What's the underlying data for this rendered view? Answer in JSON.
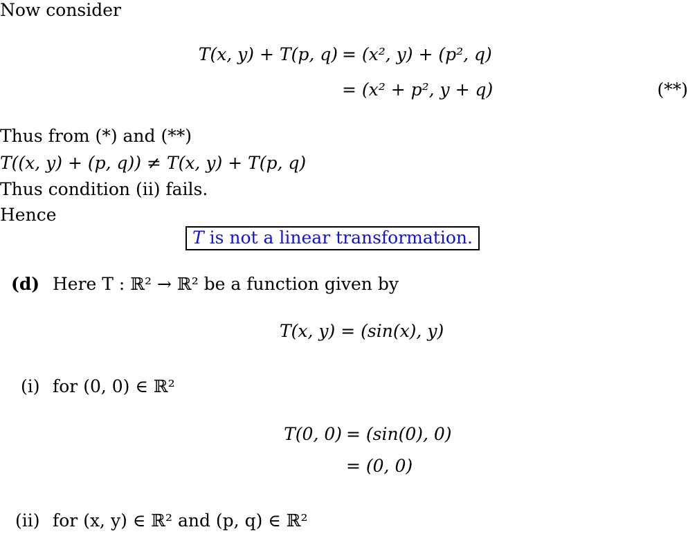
{
  "lines": {
    "now_consider": "Now consider",
    "eq1_lhs": "T(x, y) + T(p, q)",
    "eq1_rhs": "= (x², y) + (p², q)",
    "eq2_rhs": "= (x² + p², y + q)",
    "eq2_tag": "(**)",
    "thus_from": "Thus from (*) and (**)",
    "inequality": "T((x, y) + (p, q)) ≠ T(x, y) + T(p, q)",
    "condition_fails": "Thus condition (ii) fails.",
    "hence": "Hence",
    "conclusion_T": "T",
    "conclusion_text": " is not a linear transformation.",
    "part_d_label": "(d)",
    "part_d_text": "Here T : ℝ² → ℝ² be a function given by",
    "def_eq": "T(x, y) = (sin(x), y)",
    "item_i_label": "(i)",
    "item_i_text": "for (0, 0) ∈ ℝ²",
    "eq3_lhs": "T(0, 0)",
    "eq3_rhs": "= (sin(0), 0)",
    "eq4_rhs": "= (0, 0)",
    "item_ii_label": "(ii)",
    "item_ii_text": "for (x, y) ∈ ℝ² and (p, q) ∈ ℝ²"
  },
  "colors": {
    "conclusion": "#1010e0"
  }
}
